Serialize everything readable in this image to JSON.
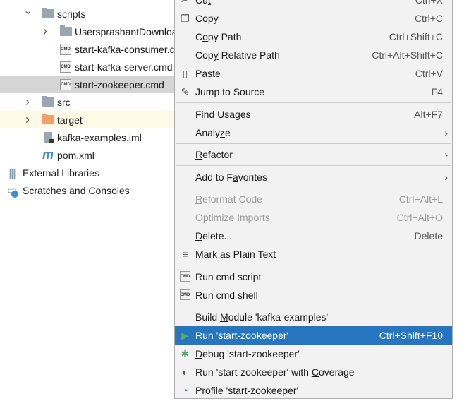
{
  "tree": [
    {
      "label": "scripts",
      "icon": "folder",
      "level": 1,
      "arrow": "down"
    },
    {
      "label": "UsersprashantDownloads",
      "icon": "folder",
      "level": 2,
      "arrow": "right"
    },
    {
      "label": "start-kafka-consumer.cmd",
      "icon": "cmd",
      "level": 2
    },
    {
      "label": "start-kafka-server.cmd",
      "icon": "cmd",
      "level": 2
    },
    {
      "label": "start-zookeeper.cmd",
      "icon": "cmd",
      "level": 2,
      "selected": true
    },
    {
      "label": "src",
      "icon": "folder",
      "level": 1,
      "arrow": "right"
    },
    {
      "label": "target",
      "icon": "folder-orange",
      "level": 1,
      "arrow": "right",
      "excluded": true
    },
    {
      "label": "kafka-examples.iml",
      "icon": "module-file",
      "level": 1
    },
    {
      "label": "pom.xml",
      "icon": "maven",
      "level": 1
    },
    {
      "label": "External Libraries",
      "icon": "libraries",
      "level": 0
    },
    {
      "label": "Scratches and Consoles",
      "icon": "scratches",
      "level": 0
    }
  ],
  "cmd_icon_text": "CMD",
  "maven_icon_text": "m",
  "menu": [
    {
      "label": "Cut",
      "mn": 2,
      "shortcut": "Ctrl+X",
      "icon": "scissors-icon",
      "glyph": "✂"
    },
    {
      "label": "Copy",
      "mn": 0,
      "shortcut": "Ctrl+C",
      "icon": "copy-icon",
      "glyph": "❐"
    },
    {
      "label": "Copy Path",
      "mn": 1,
      "shortcut": "Ctrl+Shift+C"
    },
    {
      "label": "Copy Relative Path",
      "mn": 3,
      "shortcut": "Ctrl+Alt+Shift+C"
    },
    {
      "label": "Paste",
      "mn": 0,
      "shortcut": "Ctrl+V",
      "icon": "clipboard-icon",
      "glyph": "▯"
    },
    {
      "label": "Jump to Source",
      "shortcut": "F4",
      "icon": "pencil-icon",
      "glyph": "✎"
    },
    {
      "sep": true
    },
    {
      "label": "Find Usages",
      "mn": 5,
      "shortcut": "Alt+F7"
    },
    {
      "label": "Analyze",
      "mn": 5,
      "submenu": true
    },
    {
      "sep": true
    },
    {
      "label": "Refactor",
      "mn": 0,
      "submenu": true
    },
    {
      "sep": true
    },
    {
      "label": "Add to Favorites",
      "mn": 8,
      "submenu": true
    },
    {
      "sep": true
    },
    {
      "label": "Reformat Code",
      "mn": 0,
      "shortcut": "Ctrl+Alt+L",
      "disabled": true
    },
    {
      "label": "Optimize Imports",
      "mn": 6,
      "shortcut": "Ctrl+Alt+O",
      "disabled": true
    },
    {
      "label": "Delete...",
      "mn": 0,
      "shortcut": "Delete"
    },
    {
      "label": "Mark as Plain Text",
      "icon": "plain-text-icon",
      "glyph": "≡"
    },
    {
      "sep": true
    },
    {
      "label": "Run cmd script",
      "icon": "cmd-file-icon",
      "cmd": true
    },
    {
      "label": "Run cmd shell",
      "icon": "cmd-file-icon",
      "cmd": true
    },
    {
      "sep": true
    },
    {
      "label": "Build Module 'kafka-examples'",
      "mn": 6
    },
    {
      "label": "Run 'start-zookeeper'",
      "mn": 1,
      "shortcut": "Ctrl+Shift+F10",
      "icon": "run-icon",
      "glyph": "▶",
      "color": "#59a869",
      "highlighted": true
    },
    {
      "label": "Debug 'start-zookeeper'",
      "mn": 0,
      "icon": "debug-icon",
      "glyph": "✱",
      "color": "#59a869"
    },
    {
      "label": "Run 'start-zookeeper' with Coverage",
      "mn": 27,
      "icon": "coverage-icon",
      "glyph": "◐",
      "color": "#555"
    },
    {
      "label": "Profile 'start-zookeeper'",
      "icon": "profiler-icon",
      "glyph": "◔",
      "color": "#3d8fd1"
    }
  ],
  "colors": {
    "highlight": "#2675bf",
    "selected_row": "#d5d5d5",
    "excluded_folder": "#f4a26b"
  }
}
